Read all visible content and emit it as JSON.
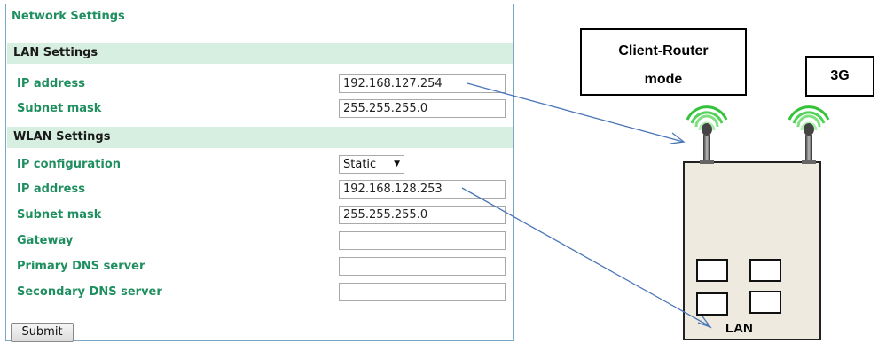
{
  "panel": {
    "title": "Network Settings",
    "lan_section": "LAN Settings",
    "lan_ip_label": "IP address",
    "lan_ip_value": "192.168.127.254",
    "lan_mask_label": "Subnet mask",
    "lan_mask_value": "255.255.255.0",
    "wlan_section": "WLAN Settings",
    "ip_config_label": "IP configuration",
    "ip_config_value": "Static",
    "wlan_ip_label": "IP address",
    "wlan_ip_value": "192.168.128.253",
    "wlan_mask_label": "Subnet mask",
    "wlan_mask_value": "255.255.255.0",
    "gateway_label": "Gateway",
    "gateway_value": "",
    "dns1_label": "Primary DNS server",
    "dns1_value": "",
    "dns2_label": "Secondary DNS server",
    "dns2_value": "",
    "submit_label": "Submit"
  },
  "diagram": {
    "client_router_line1": "Client-Router",
    "client_router_line2": "mode",
    "threeg_label": "3G",
    "lan_label": "LAN"
  },
  "colors": {
    "label_green": "#1f8f5f",
    "section_bg": "#d6efe0",
    "arrow_blue": "#4a76b8",
    "signal_green": "#35c23a",
    "device_fill": "#eeeae0"
  }
}
